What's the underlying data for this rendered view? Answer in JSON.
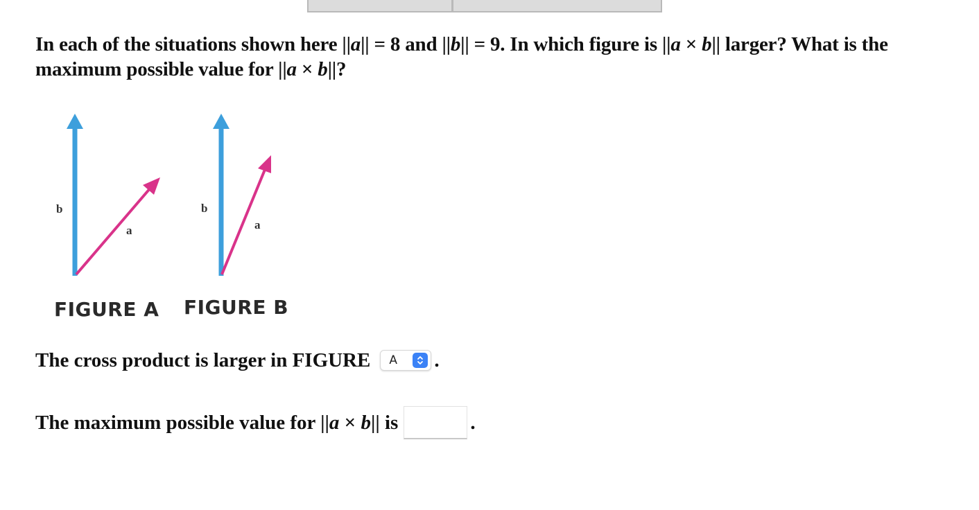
{
  "top_tabs": [
    {
      "label": ""
    },
    {
      "label": ""
    }
  ],
  "question": {
    "p1": "In each of the situations shown here ||",
    "v_a1": "a",
    "p2": "|| = 8 and ||",
    "v_b1": "b",
    "p3": "|| = 9. In which figure is ||",
    "v_a2": "a",
    "p4": " × ",
    "v_b2": "b",
    "p5": "|| larger? What is the maximum possible value for ||",
    "v_a3": "a",
    "p6": " × ",
    "v_b3": "b",
    "p7": "||?"
  },
  "figures": [
    {
      "caption": "FIGURE A",
      "vector_b_label": "b",
      "vector_a_label": "a"
    },
    {
      "caption": "FIGURE B",
      "vector_b_label": "b",
      "vector_a_label": "a"
    }
  ],
  "colors": {
    "vector_b": "#3d9fdc",
    "vector_a": "#d9338a",
    "select_button": "#3b82f6"
  },
  "answer1": {
    "prefix": "The cross product is larger in FIGURE",
    "select_value": "A",
    "suffix": "."
  },
  "answer2": {
    "prefix": "The maximum possible value for ||",
    "v_a": "a",
    "times": " × ",
    "v_b": "b",
    "mid": "|| is",
    "input_value": "",
    "input_placeholder": "",
    "suffix": "."
  }
}
